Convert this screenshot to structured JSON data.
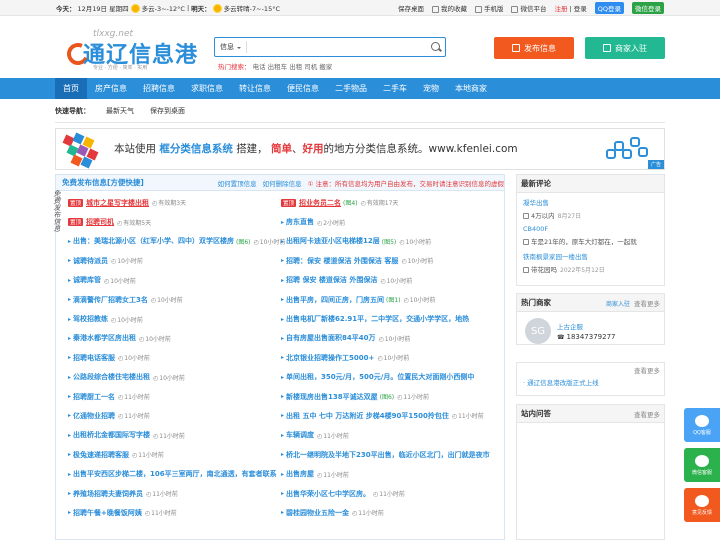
{
  "topbar": {
    "today_label": "今天：",
    "today_date": "12月19日 星期四",
    "today_weather": "多云-3~-12°C",
    "tomorrow_label": "明天：",
    "tomorrow_weather": "多云转晴-7~-15°C",
    "links": [
      "保存桌面",
      "我的收藏",
      "手机版",
      "微信平台"
    ],
    "register": "注册",
    "login": "登录",
    "qq_login": "QQ登录",
    "wx_login": "微信登录"
  },
  "logo": {
    "domain": "tlxxg.net",
    "name": "通辽信息港",
    "slogan": "专业 · 方便 · 简单 · 实用"
  },
  "search": {
    "type": "信息",
    "placeholder": "",
    "hot_label": "热门搜索：",
    "hot": "电话 出租车 出租 司机 搬家"
  },
  "actions": {
    "post": "发布信息",
    "join": "商家入驻"
  },
  "nav": [
    "首页",
    "房产信息",
    "招聘信息",
    "求职信息",
    "转让信息",
    "便民信息",
    "二手物品",
    "二手车",
    "宠物",
    "本地商家"
  ],
  "quick": {
    "label": "快速导航：",
    "items": [
      "最新天气",
      "保存到桌面"
    ]
  },
  "banner": {
    "prefix": "本站使用",
    "hl1": "框分类信息系统",
    "mid": "搭建，",
    "hl2": "简单",
    "sep": "、",
    "hl3": "好用",
    "suffix": "的地方分类信息系统。www.kfenlei.com",
    "ad": "广告"
  },
  "main": {
    "title": "免费发布信息[方便快捷]",
    "link1": "如何置顶信息",
    "link2": "如何删除信息",
    "notice": "① 注意：所有信息均为用户自由发布，交易时请注意识别信息的虚假",
    "side": "免费发布信息",
    "left": [
      {
        "tag": "置顶",
        "title": "城市之星写字楼出租",
        "red": true,
        "time": "有效期3天"
      },
      {
        "tag": "置顶",
        "title": "招聘司机",
        "red": true,
        "time": "有效期5天"
      },
      {
        "title": "出售：美瑞北源小区（红军小学、四中）双学区楼房",
        "img": "(图6)",
        "time": "10小时前"
      },
      {
        "title": "诚聘待派员",
        "time": "10小时前"
      },
      {
        "title": "诚聘库管",
        "time": "10小时前"
      },
      {
        "title": "滴滴警传厂招聘女工3名",
        "time": "10小时前"
      },
      {
        "title": "驾校招教练",
        "time": "10小时前"
      },
      {
        "title": "秦港水都学区房出租",
        "time": "10小时前"
      },
      {
        "title": "招聘电话客服",
        "time": "10小时前"
      },
      {
        "title": "公路段综合楼住宅楼出租",
        "time": "10小时前"
      },
      {
        "title": "招聘厨工一名",
        "time": "11小时前"
      },
      {
        "title": "亿通物业招聘",
        "time": "11小时前"
      },
      {
        "title": "出租桥北金都国际写字楼",
        "time": "11小时前"
      },
      {
        "title": "极兔速递招聘客服",
        "time": "11小时前"
      },
      {
        "title": "出售平安西区步梯二楼，106平三室两厅，南北通透，有套者联系",
        "time": ""
      },
      {
        "title": "养殖场招聘夫妻饲养员",
        "time": "11小时前"
      },
      {
        "title": "招聘午餐+晚餐饭阿姨",
        "time": "11小时前"
      }
    ],
    "right": [
      {
        "tag": "置顶",
        "title": "招业务员二名",
        "red": true,
        "img": "(图4)",
        "time": "有效期17天"
      },
      {
        "title": "房东直售",
        "time": "2小时前"
      },
      {
        "title": "出租阿卡迪亚小区电梯楼12层",
        "img": "(图5)",
        "time": "10小时前"
      },
      {
        "title": "招聘：保安 楼道保洁 外围保洁 客服",
        "time": "10小时前"
      },
      {
        "title": "招聘 保安 楼道保洁 外围保洁",
        "time": "10小时前"
      },
      {
        "title": "出售平房，四间正房，门房五间",
        "img": "(图1)",
        "time": "10小时前"
      },
      {
        "title": "出售电机厂新楼62.91平，二中学区，交通小学学区，地热",
        "time": ""
      },
      {
        "title": "自有房屋出售面积84平40万",
        "time": "10小时前"
      },
      {
        "title": "北京银业招聘操作工5000+",
        "time": "10小时前"
      },
      {
        "title": "单间出租，350元/月，500元/月。位置民大对面刚小西侧中",
        "time": ""
      },
      {
        "title": "新楼现房出售138平诚达双屋",
        "img": "(图6)",
        "time": "11小时前"
      },
      {
        "title": "出租 五中 七中 万达附近 步梯4楼90平1500拎包住",
        "time": "11小时前"
      },
      {
        "title": "车辆调度",
        "time": "11小时前"
      },
      {
        "title": "桥北一继明院及半地下230平出售，临近小区北门，出门就是夜市",
        "time": ""
      },
      {
        "title": "出售房屋",
        "time": "11小时前"
      },
      {
        "title": "出售华荣小区七中学区房。",
        "time": "11小时前"
      },
      {
        "title": "碧桂园物业五险一金",
        "time": "11小时前"
      }
    ]
  },
  "sidebar": {
    "comments_title": "最新评论",
    "comments": [
      {
        "title": "凝华出售",
        "text": "4万以内",
        "time": "8月27日"
      },
      {
        "title": "CB400F",
        "text": "车是21年的，原车大灯都在，一起就",
        "time": ""
      },
      {
        "title": "铁南枫景家园一楼出售",
        "text": "带花园吗",
        "time": "2022年5月12日"
      }
    ],
    "shops_title": "热门商家",
    "shops_join": "商家入驻",
    "shops_more": "查看更多",
    "shop": {
      "avatar": "SG",
      "name": "上古企服",
      "phone": "18347379277"
    },
    "notice_title": "",
    "notice_more": "查看更多",
    "notice": "· 通辽信息港改版正式上线",
    "faq_title": "站内问答",
    "faq_more": "查看更多"
  },
  "float": {
    "qq": "QQ客服",
    "wx": "微信客服",
    "mail": "意见反馈"
  },
  "colors": {
    "primary": "#2b8ed9",
    "accent_red": "#e4393c",
    "post_orange": "#f2591f",
    "join_green": "#22b891"
  }
}
